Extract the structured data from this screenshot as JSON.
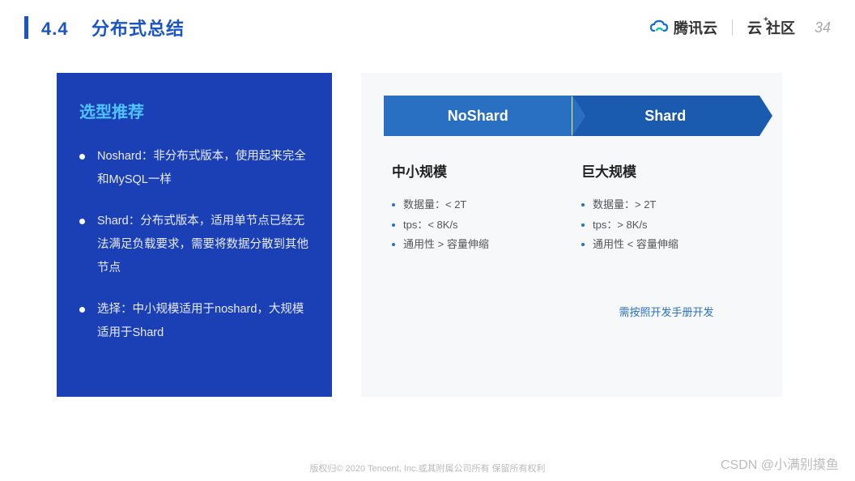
{
  "header": {
    "section_number": "4.4",
    "title": "分布式总结",
    "brand_primary": "腾讯云",
    "brand_secondary_prefix": "云",
    "brand_secondary_suffix": "社区",
    "brand_secondary_plus": "+",
    "page_number": "34"
  },
  "left": {
    "heading": "选型推荐",
    "items": [
      "Noshard：非分布式版本，使用起来完全和MySQL一样",
      "Shard：分布式版本，适用单节点已经无法满足负载要求，需要将数据分散到其他节点",
      "选择：中小规模适用于noshard，大规模适用于Shard"
    ]
  },
  "right": {
    "tabs": [
      "NoShard",
      "Shard"
    ],
    "columns": [
      {
        "title": "中小规模",
        "bullets": [
          "数据量：< 2T",
          "tps：< 8K/s",
          "通用性 > 容量伸缩"
        ]
      },
      {
        "title": "巨大规模",
        "bullets": [
          "数据量：> 2T",
          "tps：> 8K/s",
          "通用性 < 容量伸缩"
        ],
        "note": "需按照开发手册开发"
      }
    ]
  },
  "footer": {
    "copyright": "版权归© 2020 Tencent, Inc.或其附属公司所有 保留所有权利",
    "watermark": "CSDN @小满别摸鱼"
  }
}
